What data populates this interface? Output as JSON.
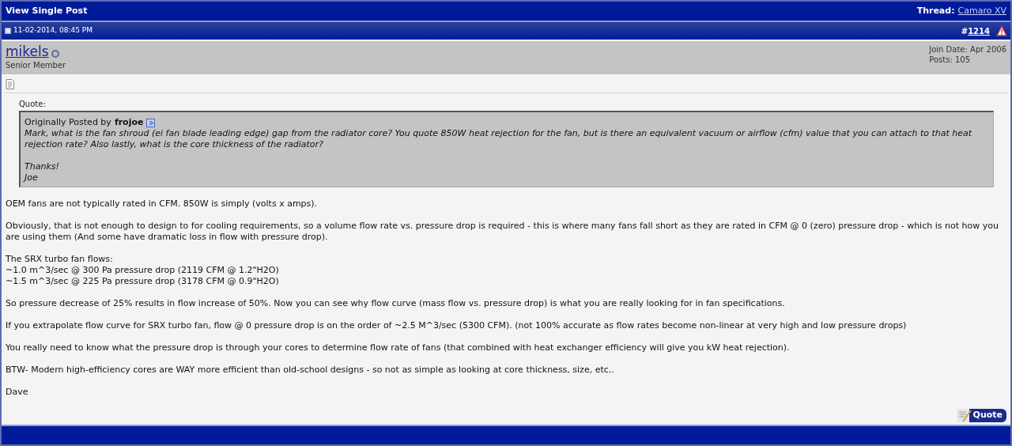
{
  "header": {
    "title": "View Single Post",
    "thread_label": "Thread:",
    "thread_link": "Camaro XV"
  },
  "post_bar": {
    "date": "11-02-2014, 08:45 PM",
    "hash": "#",
    "number": "1214"
  },
  "user": {
    "name": "mikels",
    "online": false,
    "rank": "Senior Member",
    "join_date": "Join Date: Apr 2006",
    "posts": "Posts: 105"
  },
  "quote": {
    "label": "Quote:",
    "posted_by": "Originally Posted by",
    "author": "frojoe",
    "paragraphs": [
      [
        "Mark, what is the fan shroud (ei fan blade leading edge) gap from the radiator core? You quote 850W heat rejection for the fan, but is there an equivalent vacuum or airflow (cfm) value that you can attach to that heat rejection rate? Also lastly, what is the core thickness of the radiator?"
      ],
      [
        "Thanks!",
        "Joe"
      ]
    ]
  },
  "paragraphs": [
    [
      "OEM fans are not typically rated in CFM. 850W is simply (volts x amps)."
    ],
    [
      "Obviously, that is not enough to design to for cooling requirements, so a volume flow rate vs. pressure drop is required - this is where many fans fall short as they are rated in CFM @ 0 (zero) pressure drop - which is not how you are using them (And some have dramatic loss in flow with pressure drop)."
    ],
    [
      "The SRX turbo fan flows:",
      "~1.0 m^3/sec @ 300 Pa pressure drop (2119 CFM @ 1.2\"H2O)",
      "~1.5 m^3/sec @ 225 Pa pressure drop (3178 CFM @ 0.9\"H2O)"
    ],
    [
      "So pressure decrease of 25% results in flow increase of 50%. Now you can see why flow curve (mass flow vs. pressure drop) is what you are really looking for in fan specifications."
    ],
    [
      "If you extrapolate flow curve for SRX turbo fan, flow @ 0 pressure drop is on the order of ~2.5 M^3/sec (5300 CFM). (not 100% accurate as flow rates become non-linear at very high and low pressure drops)"
    ],
    [
      "You really need to know what the pressure drop is through your cores to determine flow rate of fans (that combined with heat exchanger efficiency will give you kW heat rejection)."
    ],
    [
      "BTW- Modern high-efficiency cores are WAY more efficient than old-school designs - so not as simple as looking at core thickness, size, etc.."
    ],
    [
      "Dave"
    ]
  ],
  "quote_button": "Quote"
}
